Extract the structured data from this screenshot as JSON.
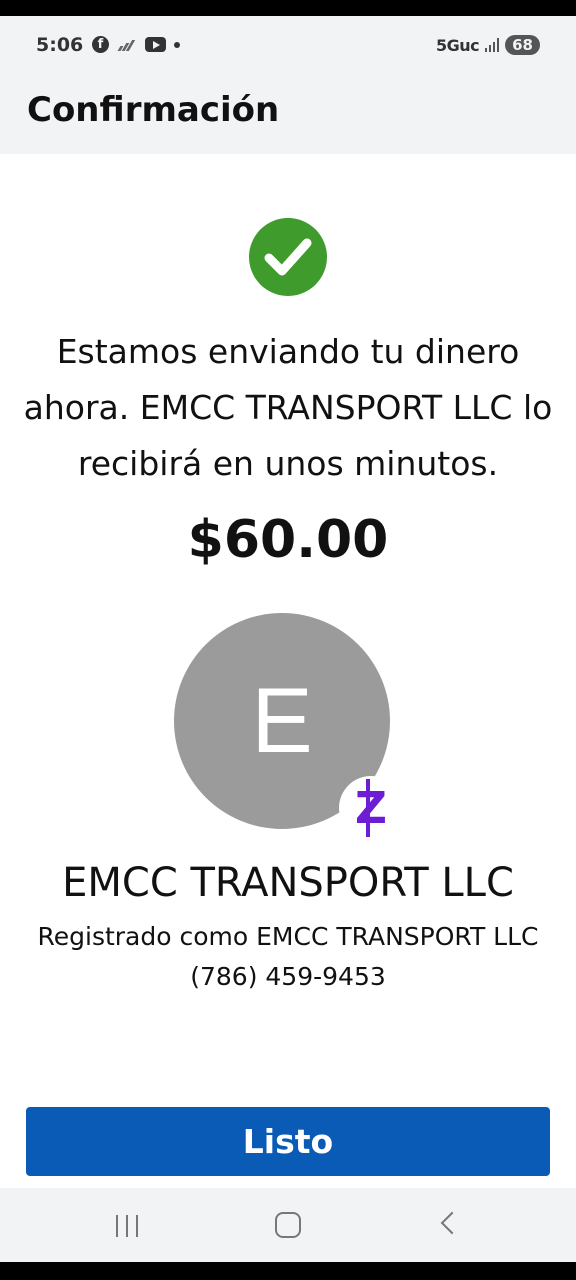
{
  "status_bar": {
    "time": "5:06",
    "network": "5Guc",
    "battery": "68",
    "icons": [
      "facebook-icon",
      "wifi-calling-icon",
      "youtube-icon",
      "notification-dot-icon",
      "signal-icon",
      "battery-icon"
    ]
  },
  "header": {
    "title": "Confirmación"
  },
  "confirmation": {
    "status_icon": "check-circle-icon",
    "message": "Estamos enviando tu dinero ahora. EMCC TRANSPORT LLC lo recibirá en unos minutos.",
    "amount": "$60.00"
  },
  "recipient": {
    "avatar_letter": "E",
    "badge_icon": "zelle-icon",
    "badge_letter": "Z",
    "name": "EMCC TRANSPORT LLC",
    "registered_as": "Registrado como EMCC TRANSPORT LLC",
    "phone": "(786) 459-9453"
  },
  "actions": {
    "done_label": "Listo"
  },
  "navigation": {
    "icons": [
      "recents-icon",
      "home-icon",
      "back-icon"
    ]
  },
  "colors": {
    "success_green": "#3e9b2c",
    "primary_blue": "#0a5bb6",
    "zelle_purple": "#6d1ed4",
    "avatar_gray": "#9b9b9b"
  }
}
